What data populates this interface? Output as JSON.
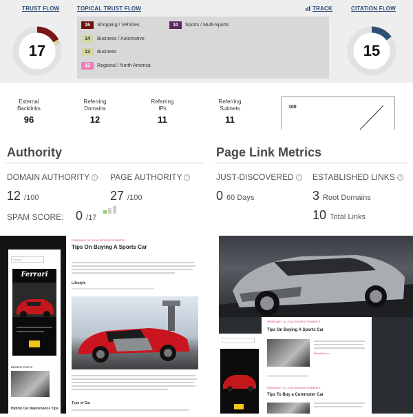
{
  "majestic": {
    "trust_flow": {
      "label": "TRUST FLOW",
      "value": "17",
      "fill": 0.17,
      "color": "#7a1616"
    },
    "topical_trust_flow": {
      "label": "TOPICAL TRUST FLOW",
      "track_label": "TRACK",
      "topics": [
        {
          "score": "16",
          "name": "Shopping / Vehicles",
          "badge_color": "#6e1212",
          "text_color": "#ffffff"
        },
        {
          "score": "14",
          "name": "Business / Automotive",
          "badge_color": "#d6d8a4",
          "text_color": "#333333"
        },
        {
          "score": "13",
          "name": "Business",
          "badge_color": "#d6d8a4",
          "text_color": "#333333"
        },
        {
          "score": "12",
          "name": "Regional / North America",
          "badge_color": "#ee7fb6",
          "text_color": "#ffffff"
        },
        {
          "score": "10",
          "name": "Sports / Multi-Sports",
          "badge_color": "#5a2a5e",
          "text_color": "#ffffff"
        }
      ]
    },
    "citation_flow": {
      "label": "CITATION FLOW",
      "value": "15",
      "fill": 0.15,
      "color": "#2f5177"
    }
  },
  "stats": [
    {
      "label_1": "External",
      "label_2": "Backlinks",
      "value": "96"
    },
    {
      "label_1": "Referring",
      "label_2": "Domains",
      "value": "12"
    },
    {
      "label_1": "Referring",
      "label_2": "IPs",
      "value": "11"
    },
    {
      "label_1": "Referring",
      "label_2": "Subnets",
      "value": "11"
    }
  ],
  "sparkline": {
    "label": "100"
  },
  "authority": {
    "title": "Authority",
    "domain_authority": {
      "label": "DOMAIN AUTHORITY",
      "value": "12",
      "suffix": "/100"
    },
    "page_authority": {
      "label": "PAGE AUTHORITY",
      "value": "27",
      "suffix": "/100"
    },
    "spam_score": {
      "label": "SPAM SCORE:",
      "value": "0",
      "suffix": "/17"
    }
  },
  "page_link_metrics": {
    "title": "Page Link Metrics",
    "just_discovered": {
      "label": "JUST-DISCOVERED",
      "value": "0",
      "suffix": "60 Days"
    },
    "established_links": {
      "label": "ESTABLISHED LINKS",
      "root_value": "3",
      "root_suffix": "Root Domains",
      "total_value": "10",
      "total_suffix": "Total Links"
    }
  },
  "preview": {
    "left": {
      "search_placeholder": "Search...",
      "ad_brand": "Ferrari",
      "recent_posts_label": "RECENT POSTS",
      "recent_post_title": "Hybrid Car Maintenance Tips"
    },
    "middle": {
      "meta": "FEBRUARY 20, 2016 GEORGE ROBERTS",
      "title": "Tips On Buying A Sports Car",
      "lifestyle": "Lifestyle",
      "type_of_car": "Type of Car"
    },
    "right": {
      "meta": "FEBRUARY 20, 2016 GEORGE ROBERTS",
      "title": "Tips On Buying A Sports Car",
      "read_more": "Read More »",
      "second_title": "Tips To Buy a Commuter Car"
    }
  },
  "icons": {
    "info": "info-circle-icon",
    "track": "bar-chart-icon"
  }
}
